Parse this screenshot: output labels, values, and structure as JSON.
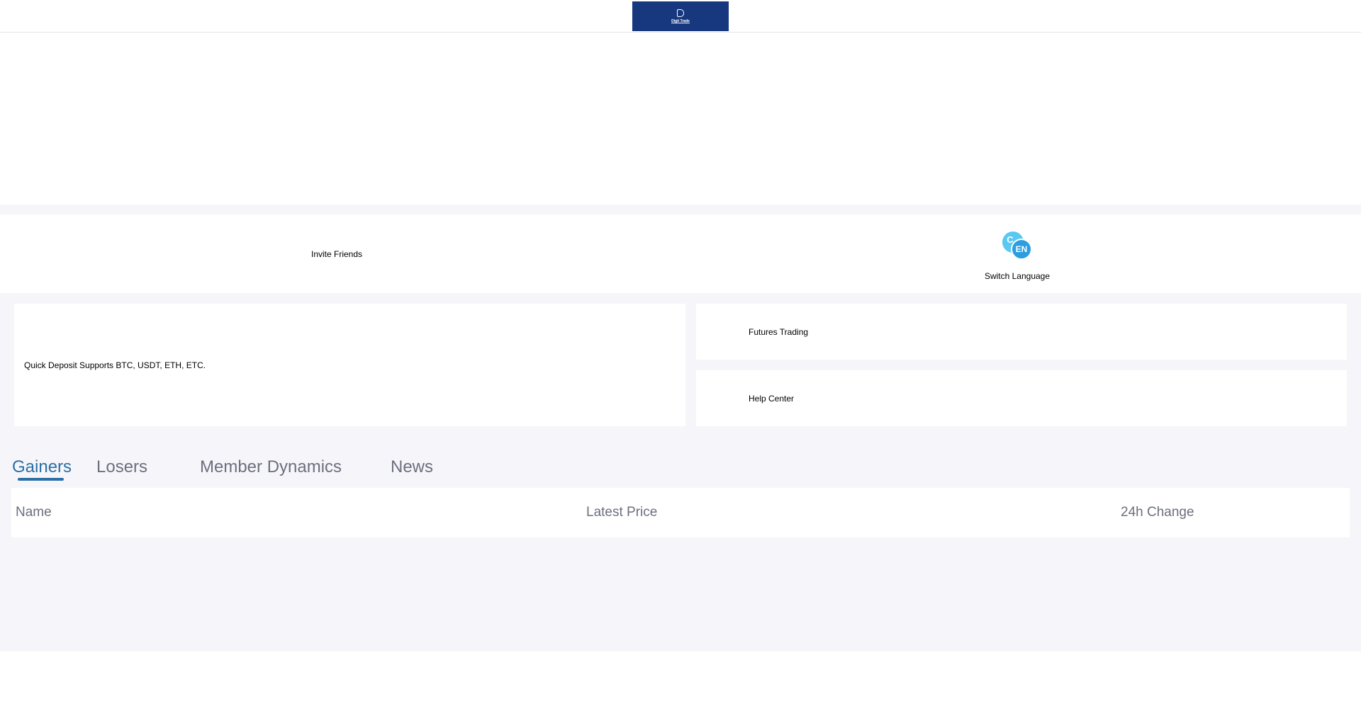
{
  "header": {
    "logo_text": "Digit Trade"
  },
  "quick_links": {
    "invite_label": "Invite Friends",
    "language_label": "Switch Language",
    "language_icon_text_back": "C",
    "language_icon_text_front": "EN"
  },
  "cards": {
    "deposit_label": "Quick Deposit Supports BTC, USDT, ETH, ETC.",
    "futures_label": "Futures Trading",
    "help_label": "Help Center"
  },
  "tabs": [
    {
      "label": "Gainers",
      "active": true
    },
    {
      "label": "Losers",
      "active": false
    },
    {
      "label": "Member Dynamics",
      "active": false
    },
    {
      "label": "News",
      "active": false
    }
  ],
  "market_table": {
    "columns": [
      "Name",
      "Latest Price",
      "24h Change"
    ]
  },
  "colors": {
    "brand": "#17387f",
    "active_tab": "#2a6fa6",
    "background": "#f6f6fa",
    "muted_text": "#6c6f7e"
  }
}
